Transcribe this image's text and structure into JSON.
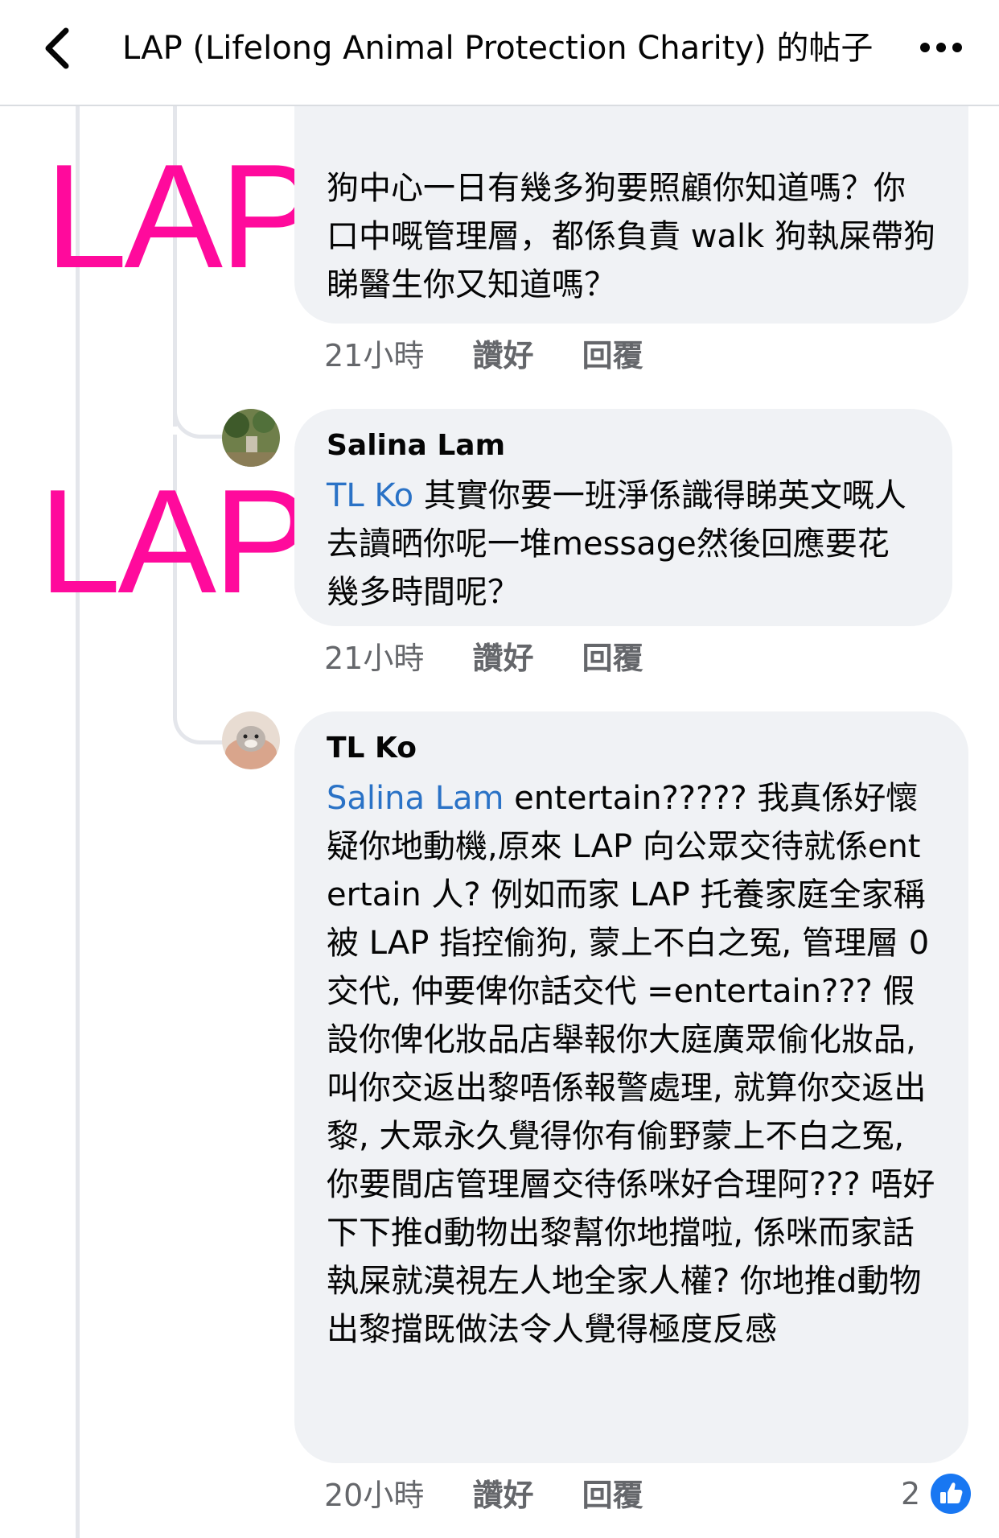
{
  "header": {
    "title": "LAP (Lifelong Animal Protection Charity) 的帖子"
  },
  "watermark": {
    "text": "LAP"
  },
  "comments": [
    {
      "text": "狗中心一日有幾多狗要照顧你知道嗎？你口中嘅管理層，都係負責 walk 狗執屎帶狗睇醫生你又知道嗎？",
      "time": "21小時",
      "like": "讚好",
      "reply": "回覆"
    },
    {
      "author": "Salina Lam",
      "mention": "TL Ko",
      "text": " 其實你要一班淨係識得睇英文嘅人去讀晒你呢一堆message然後回應要花幾多時間呢？",
      "time": "21小時",
      "like": "讚好",
      "reply": "回覆"
    },
    {
      "author": "TL Ko",
      "mention": "Salina Lam",
      "text": " entertain????? 我真係好懷疑你地動機,原來 LAP 向公眾交待就係entertain 人? 例如而家 LAP 托養家庭全家稱被 LAP 指控偷狗, 蒙上不白之冤, 管理層 0 交代, 仲要俾你話交代 =entertain??? 假設你俾化妝品店舉報你大庭廣眾偷化妝品, 叫你交返出黎唔係報警處理, 就算你交返出黎, 大眾永久覺得你有偷野蒙上不白之冤, 你要間店管理層交待係咪好合理阿??? 唔好下下推d動物出黎幫你地擋啦, 係咪而家話執屎就漠視左人地全家人權? 你地推d動物出黎擋既做法令人覺得極度反感",
      "time": "20小時",
      "like": "讚好",
      "reply": "回覆",
      "reaction_count": "2"
    }
  ],
  "colors": {
    "watermark": "#ff0a9c",
    "mention": "#2a72c6",
    "bubble": "#f0f2f5",
    "like_icon": "#1877f2"
  }
}
